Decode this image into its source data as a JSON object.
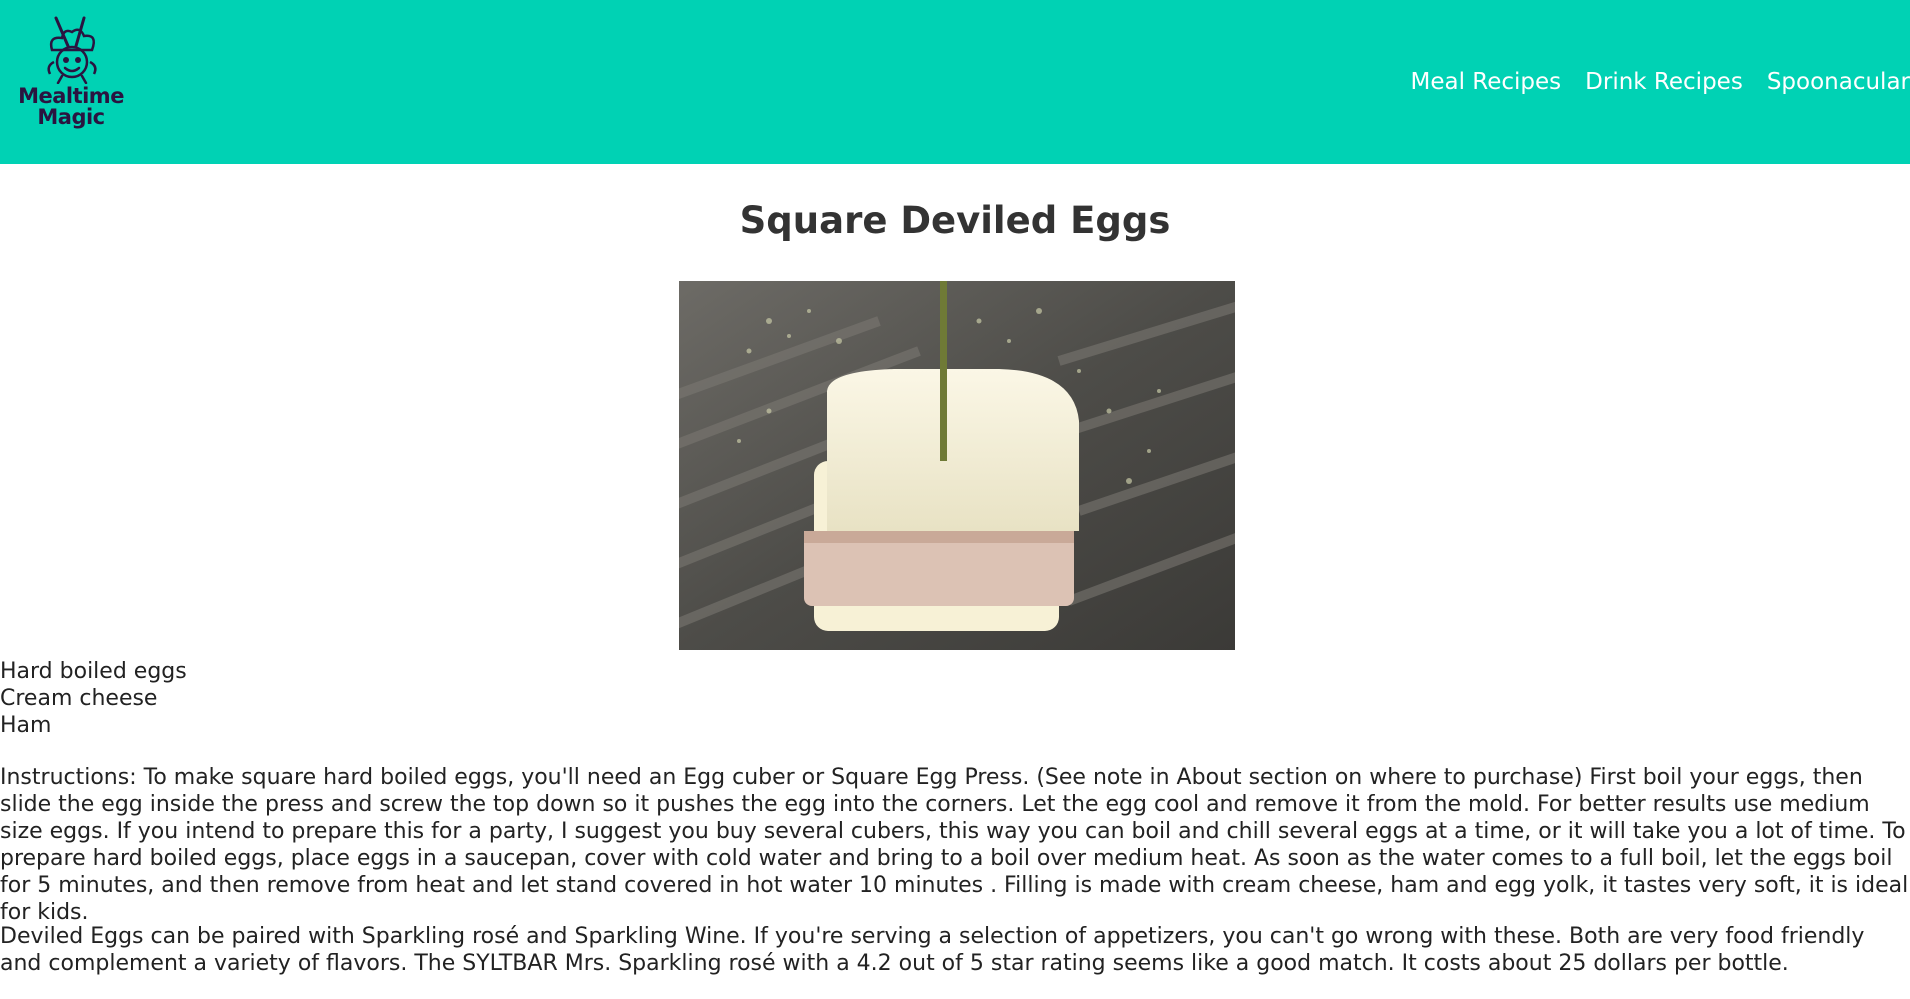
{
  "header": {
    "brand": {
      "line1": "Mealtime",
      "line2": "Magic",
      "logo_icon": "chef-character-icon"
    },
    "nav": [
      {
        "label": "Meal Recipes"
      },
      {
        "label": "Drink Recipes"
      },
      {
        "label": "Spoonacular"
      }
    ],
    "background_color": "#00d2b4"
  },
  "recipe": {
    "title": "Square Deviled Eggs",
    "image_icon": "recipe-photo",
    "ingredients": [
      "Hard boiled eggs",
      "Cream cheese",
      "Ham"
    ],
    "instructions": "Instructions: To make square hard boiled eggs, you'll need an Egg cuber or Square Egg Press. (See note in About section on where to purchase) First boil your eggs, then slide the egg inside the press and screw the top down so it pushes the egg into the corners. Let the egg cool and remove it from the mold. For better results use medium size eggs. If you intend to prepare this for a party, I suggest you buy several cubers, this way you can boil and chill several eggs at a time, or it will take you a lot of time. To prepare hard boiled eggs, place eggs in a saucepan, cover with cold water and bring to a boil over medium heat. As soon as the water comes to a full boil, let the eggs boil for 5 minutes, and then remove from heat and let stand covered in hot water 10 minutes . Filling is made with cream cheese, ham and egg yolk, it tastes very soft, it is ideal for kids.",
    "pairing": "Deviled Eggs can be paired with Sparkling rosé and Sparkling Wine. If you're serving a selection of appetizers, you can't go wrong with these. Both are very food friendly and complement a variety of flavors. The SYLTBAR Mrs. Sparkling rosé with a 4.2 out of 5 star rating seems like a good match. It costs about 25 dollars per bottle."
  }
}
